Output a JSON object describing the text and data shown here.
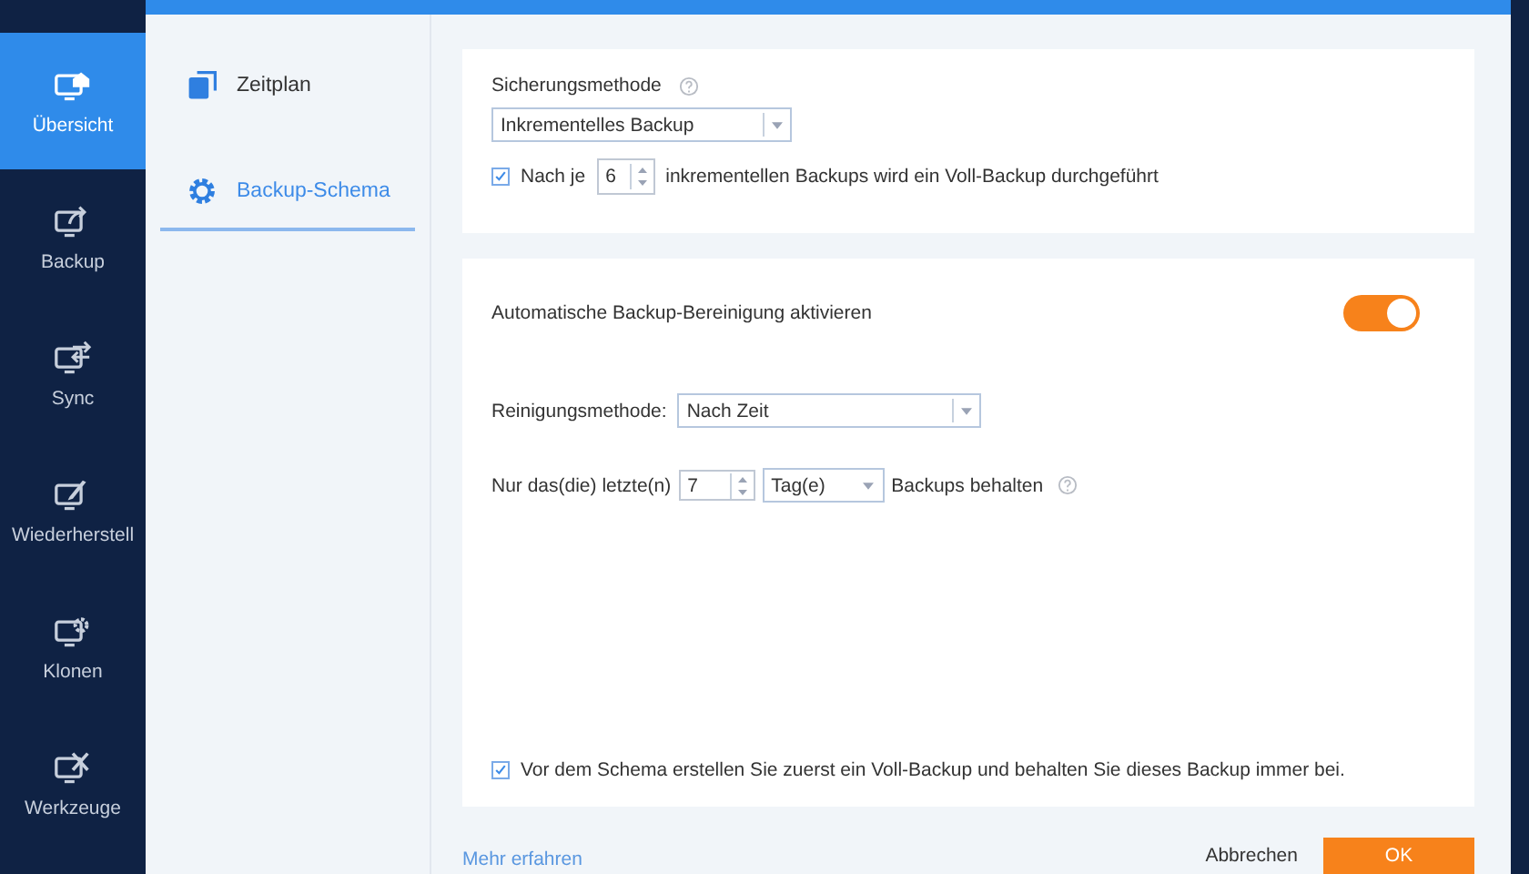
{
  "nav": [
    {
      "label": "Übersicht",
      "kind": "overview",
      "selected": true
    },
    {
      "label": "Backup",
      "kind": "backup",
      "selected": false
    },
    {
      "label": "Sync",
      "kind": "sync",
      "selected": false
    },
    {
      "label": "Wiederherstell",
      "kind": "restore",
      "selected": false
    },
    {
      "label": "Klonen",
      "kind": "clone",
      "selected": false
    },
    {
      "label": "Werkzeuge",
      "kind": "tools",
      "selected": false
    }
  ],
  "subnav": [
    {
      "label": "Zeitplan",
      "kind": "schedule",
      "selected": false
    },
    {
      "label": "Backup-Schema",
      "kind": "scheme",
      "selected": true
    }
  ],
  "method": {
    "label": "Sicherungsmethode",
    "value": "Inkrementelles Backup"
  },
  "full_backup": {
    "checked": true,
    "prefix": "Nach je",
    "value": "6",
    "suffix": "inkrementellen Backups wird ein Voll-Backup durchgeführt"
  },
  "cleanup": {
    "label": "Automatische Backup-Bereinigung aktivieren",
    "on": true
  },
  "cleanup_method": {
    "label": "Reinigungsmethode:",
    "value": "Nach Zeit"
  },
  "keep": {
    "prefix": "Nur das(die) letzte(n)",
    "value": "7",
    "unit": "Tag(e)",
    "suffix": "Backups behalten"
  },
  "first_full": {
    "checked": true,
    "text": "Vor dem Schema erstellen Sie zuerst ein Voll-Backup und behalten Sie dieses Backup immer bei."
  },
  "footer": {
    "link": "Mehr erfahren",
    "cancel": "Abbrechen",
    "ok": "OK"
  }
}
